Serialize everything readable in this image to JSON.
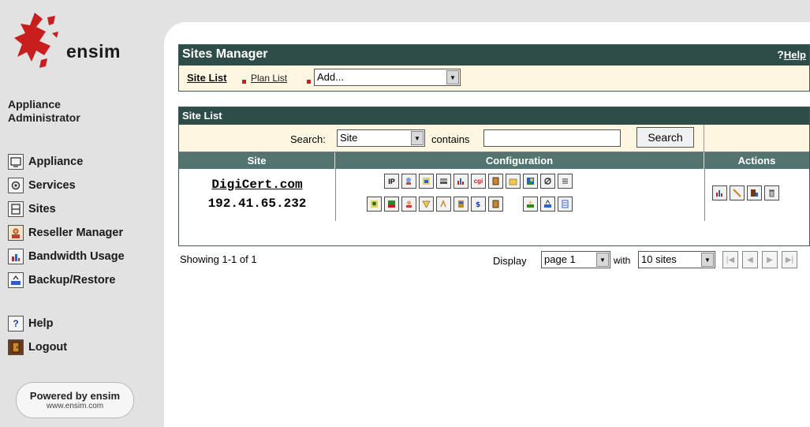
{
  "sidebar": {
    "logo_text": "ensim",
    "role_title": "Appliance\nAdministrator",
    "nav": [
      {
        "label": "Appliance",
        "icon": "appliance-icon"
      },
      {
        "label": "Services",
        "icon": "services-icon"
      },
      {
        "label": "Sites",
        "icon": "sites-icon"
      },
      {
        "label": "Reseller Manager",
        "icon": "reseller-icon"
      },
      {
        "label": "Bandwidth Usage",
        "icon": "bandwidth-icon"
      },
      {
        "label": "Backup/Restore",
        "icon": "backup-icon"
      }
    ],
    "help_label": "Help",
    "logout_label": "Logout",
    "powered_line1": "Powered by ensim",
    "powered_line2": "www.ensim.com"
  },
  "sites_manager": {
    "title": "Sites Manager",
    "help_q": "?",
    "help_label": "Help",
    "tab_site_list": "Site List",
    "tab_plan_list": "Plan List",
    "add_select_value": "Add..."
  },
  "site_list": {
    "title": "Site List",
    "search_label": "Search:",
    "search_field": "Site",
    "contains_label": "contains",
    "search_value": "",
    "search_button": "Search",
    "columns": [
      "Site",
      "Configuration",
      "Actions"
    ],
    "rows": [
      {
        "site": "DigiCert.com",
        "ip": "192.41.65.232"
      }
    ],
    "config_icon_text": {
      "ip": "IP",
      "cgi": "cgi"
    }
  },
  "footer": {
    "showing": "Showing 1-1 of 1",
    "display_label": "Display",
    "page_value": "page 1",
    "with_label": "with",
    "per_page_value": "10 sites"
  },
  "colors": {
    "sidebar_bg": "#e2e2e2",
    "header_dark": "#2f4d48",
    "column_header": "#53746f",
    "cream_bar": "#fdf7e2",
    "accent_red": "#c81e1e"
  }
}
